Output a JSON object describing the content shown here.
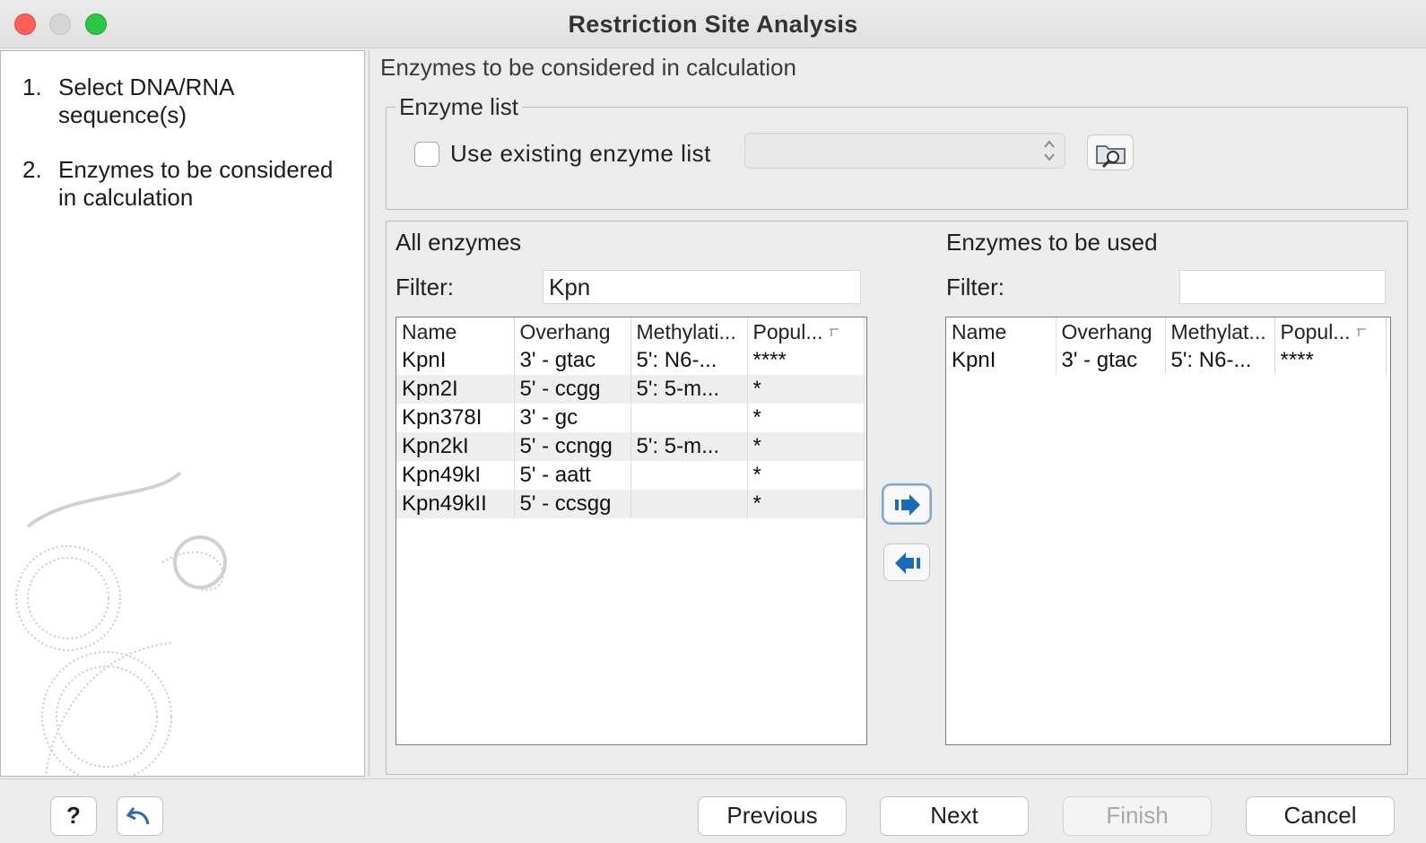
{
  "window": {
    "title": "Restriction Site Analysis"
  },
  "wizard_steps": [
    {
      "number": "1.",
      "label": "Select DNA/RNA sequence(s)"
    },
    {
      "number": "2.",
      "label": "Enzymes to be considered in calculation"
    }
  ],
  "main": {
    "section_title": "Enzymes to be considered in calculation",
    "enzyme_list": {
      "legend": "Enzyme list",
      "checkbox_label": "Use existing enzyme list",
      "checkbox_checked": false,
      "combo_value": ""
    },
    "all_enzymes": {
      "title": "All enzymes",
      "filter_label": "Filter:",
      "filter_value": "Kpn",
      "columns": [
        "Name",
        "Overhang",
        "Methylati...",
        "Popul..."
      ],
      "rows": [
        [
          "KpnI",
          "3' - gtac",
          "5': N6-...",
          "****"
        ],
        [
          "Kpn2I",
          "5' - ccgg",
          "5': 5-m...",
          "*"
        ],
        [
          "Kpn378I",
          "3' - gc",
          "",
          "*"
        ],
        [
          "Kpn2kI",
          "5' - ccngg",
          "5': 5-m...",
          "*"
        ],
        [
          "Kpn49kI",
          "5' - aatt",
          "",
          "*"
        ],
        [
          "Kpn49kII",
          "5' - ccsgg",
          "",
          "*"
        ]
      ]
    },
    "enzymes_used": {
      "title": "Enzymes to be used",
      "filter_label": "Filter:",
      "filter_value": "",
      "columns": [
        "Name",
        "Overhang",
        "Methylat...",
        "Popul..."
      ],
      "rows": [
        [
          "KpnI",
          "3' - gtac",
          "5': N6-...",
          "****"
        ]
      ]
    },
    "transfer_icons": [
      "arrow-right-icon",
      "arrow-left-icon"
    ]
  },
  "footer": {
    "help_label": "?",
    "previous_label": "Previous",
    "next_label": "Next",
    "finish_label": "Finish",
    "cancel_label": "Cancel"
  },
  "colors": {
    "close": "#ff5f57",
    "maximize": "#28c840",
    "arrow_blue": "#1a6bb8"
  }
}
